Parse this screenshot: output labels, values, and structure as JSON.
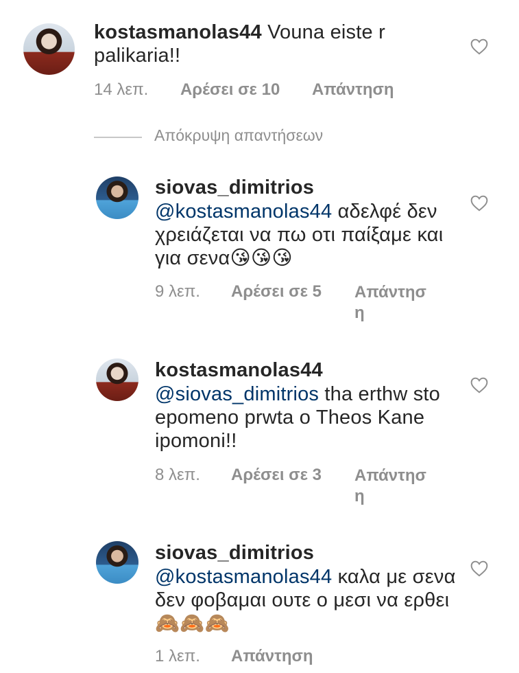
{
  "comments": [
    {
      "username": "kostasmanolas44",
      "text_before": " Vouna eiste r palikaria!!",
      "time": "14 λεπ.",
      "likes": "Αρέσει σε 10",
      "reply": "Απάντηση",
      "avatar": "user-avatar-icon"
    },
    {
      "username": "siovas_dimitrios",
      "mention": "@kostasmanolas44",
      "text": " αδελφέ δεν χρειάζεται να πω οτι παίξαμε και για σενα",
      "emojis": "😘😘😘",
      "time": "9 λεπ.",
      "likes": "Αρέσει σε 5",
      "reply": "Απάντηση",
      "avatar": "user-avatar-icon"
    },
    {
      "username": "kostasmanolas44",
      "mention": "@siovas_dimitrios",
      "text": " tha erthw sto epomeno prwta o Theos Kane ipomoni!!",
      "time": "8 λεπ.",
      "likes": "Αρέσει σε 3",
      "reply": "Απάντηση",
      "avatar": "user-avatar-icon"
    },
    {
      "username": "siovas_dimitrios",
      "mention": "@kostasmanolas44",
      "text": " καλα με σενα δεν φοβαμαι ουτε ο μεσι να ερθει ",
      "emojis": "🙈🙈🙈",
      "time": "1 λεπ.",
      "reply": "Απάντηση",
      "avatar": "user-avatar-icon"
    }
  ],
  "hide_replies": "Απόκρυψη απαντήσεων",
  "colors": {
    "text": "#262626",
    "meta": "#8e8e8e",
    "mention": "#003569"
  },
  "icons": {
    "like": "heart-outline-icon"
  }
}
